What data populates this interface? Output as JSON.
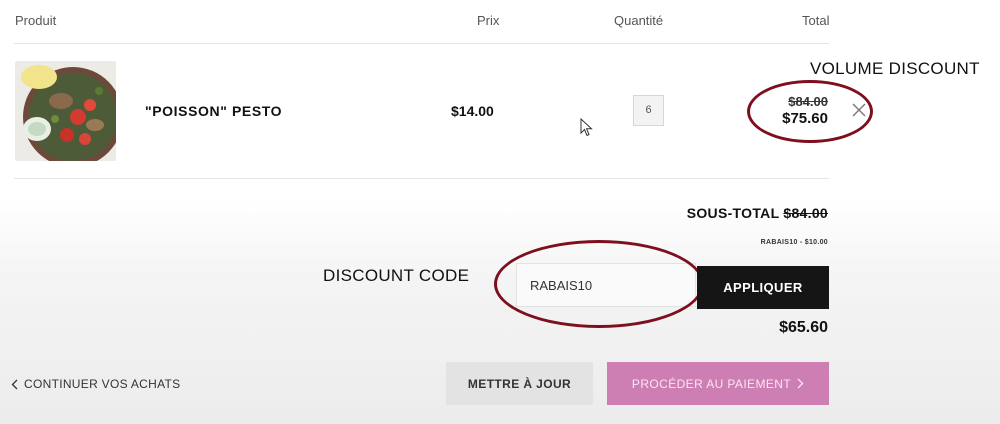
{
  "table_header": {
    "product": "Produit",
    "price": "Prix",
    "quantity": "Quantité",
    "total": "Total"
  },
  "cart_item": {
    "name": "\"POISSON\" PESTO",
    "price": "$14.00",
    "quantity": "6",
    "original_total": "$84.00",
    "discounted_total": "$75.60",
    "image_icon": "food-plate-image",
    "remove_icon": "close-icon"
  },
  "annotations": {
    "volume_discount": "VOLUME DISCOUNT",
    "discount_code": "DISCOUNT CODE",
    "circle_color": "#7d0f1e"
  },
  "summary": {
    "subtotal_label": "SOUS-TOTAL",
    "subtotal_value": "$84.00",
    "discount_line": "RABAIS10 - $10.00",
    "grand_total": "$65.60"
  },
  "discount_form": {
    "code_value": "RABAIS10",
    "apply_label": "APPLIQUER"
  },
  "footer": {
    "continue_label": "CONTINUER VOS ACHATS",
    "update_label": "METTRE À JOUR",
    "checkout_label": "PROCÉDER AU PAIEMENT"
  },
  "colors": {
    "checkout_bg": "#cd7eb2",
    "apply_bg": "#151515"
  }
}
